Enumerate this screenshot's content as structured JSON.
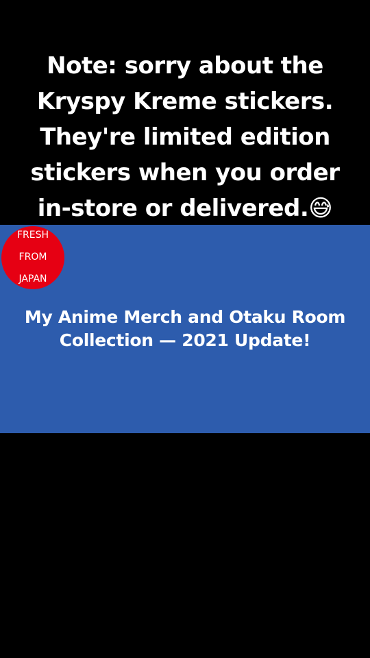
{
  "caption": {
    "lines": [
      "Note: sorry about the",
      "Kryspy Kreme stickers.",
      "They're limited edition",
      "stickers when you order",
      "in-store or delivered.😅"
    ]
  },
  "badge": {
    "lines": [
      "FRESH",
      "FROM",
      "JAPAN"
    ]
  },
  "video": {
    "title_lines": [
      "My Anime Merch and Otaku Room",
      "Collection — 2021 Update!"
    ]
  },
  "colors": {
    "background": "#000000",
    "panel": "#2d5cad",
    "badge": "#e60013",
    "text": "#ffffff"
  }
}
